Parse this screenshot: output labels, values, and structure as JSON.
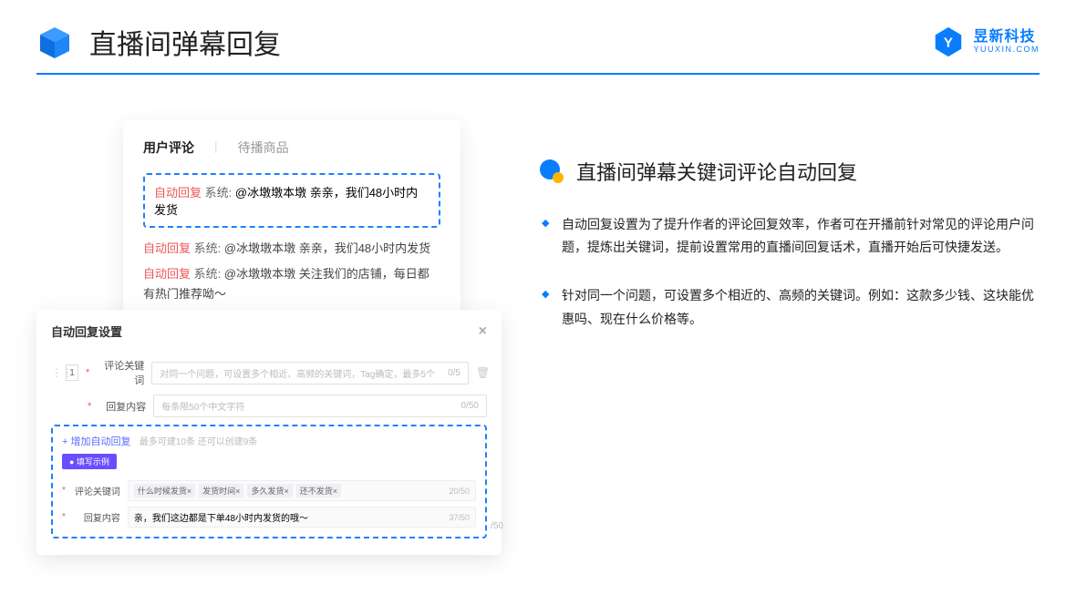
{
  "header": {
    "title": "直播间弹幕回复",
    "brand_cn": "昱新科技",
    "brand_en": "YUUXIN.COM"
  },
  "comment_panel": {
    "tab_active": "用户评论",
    "tab_inactive": "待播商品",
    "highlight": {
      "tag": "自动回复",
      "sys": "系统:",
      "text": "@冰墩墩本墩 亲亲，我们48小时内发货"
    },
    "lines": [
      {
        "tag": "自动回复",
        "sys": "系统:",
        "text": "@冰墩墩本墩 亲亲，我们48小时内发货"
      },
      {
        "tag": "自动回复",
        "sys": "系统:",
        "text": "@冰墩墩本墩 关注我们的店铺，每日都有热门推荐呦～"
      }
    ]
  },
  "settings_panel": {
    "title": "自动回复设置",
    "index": "1",
    "row1": {
      "label": "评论关键词",
      "placeholder": "对同一个问题，可设置多个相近、高频的关键词，Tag确定，最多5个",
      "count": "0/5"
    },
    "row2": {
      "label": "回复内容",
      "placeholder": "每条限50个中文字符",
      "count": "0/50"
    },
    "add_link": "+ 增加自动回复",
    "add_hint": "最多可建10条 还可以创建9条",
    "example_badge": "● 填写示例",
    "ex1": {
      "label": "评论关键词",
      "tags": [
        "什么时候发货×",
        "发货时间×",
        "多久发货×",
        "还不发货×"
      ],
      "count": "20/50"
    },
    "ex2": {
      "label": "回复内容",
      "value": "亲，我们这边都是下单48小时内发货的哦～",
      "count": "37/50"
    },
    "float_count": "/50"
  },
  "right": {
    "section_title": "直播间弹幕关键词评论自动回复",
    "bullets": [
      "自动回复设置为了提升作者的评论回复效率，作者可在开播前针对常见的评论用户问题，提炼出关键词，提前设置常用的直播间回复话术，直播开始后可快捷发送。",
      "针对同一个问题，可设置多个相近的、高频的关键词。例如：这款多少钱、这块能优惠吗、现在什么价格等。"
    ]
  }
}
